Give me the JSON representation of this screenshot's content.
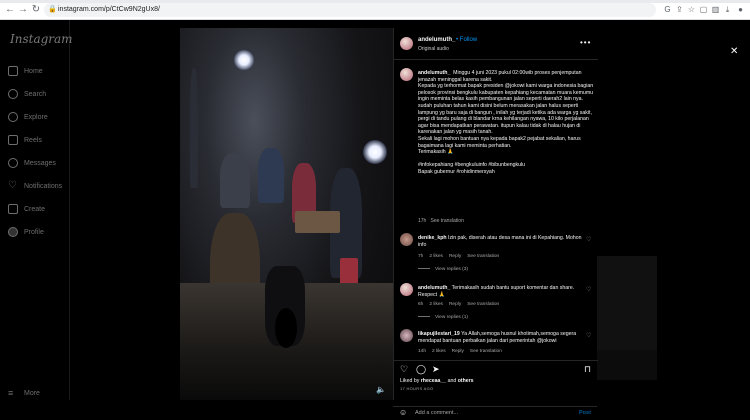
{
  "browser": {
    "url": "instagram.com/p/CtCw9N2gUx8/"
  },
  "sidebar": {
    "logo": "Instagram",
    "items": [
      {
        "label": "Home",
        "icon": "home-icon"
      },
      {
        "label": "Search",
        "icon": "search-icon"
      },
      {
        "label": "Explore",
        "icon": "explore-icon"
      },
      {
        "label": "Reels",
        "icon": "reels-icon"
      },
      {
        "label": "Messages",
        "icon": "messages-icon"
      },
      {
        "label": "Notifications",
        "icon": "heart-icon"
      },
      {
        "label": "Create",
        "icon": "create-icon"
      },
      {
        "label": "Profile",
        "icon": "profile-icon"
      }
    ],
    "more": "More"
  },
  "post": {
    "author": "andelumuth_",
    "follow": "Follow",
    "audio": "Original audio",
    "caption_author": "andelumuth_",
    "caption": "Minggu 4 juni 2023 pukul 02:00wib proses penjemputan jenazah meninggal karena sakit.\nKepada yg terhormat bapak presiden @jokowi kami warga indonesia bagian pelosok provinsi bengkulu kabupaten kepahiang kecamatan muara kemumu ingin meminta belas kasih pembangunan jalan seperti daerah2 lain nya. sudah puluhan tahun kami disini belum merasakan jalan halus seperti lampung yg baru saja di bangun , inilah yg terjadi ketika ada warga yg sakit, pergi di tandu pulang di blandar krna kehilangan nyawa, 10 kilo perjalanan agar bisa mendapatkan perawatan. itupun kalau tidak di halau hujan di karenakan jalan yg masih tanah.\nSekali lagi mohon bantuan nya kepada bapak2 pejabat sekalian, harus bagaimana lagi kami meminta perhatian.\nTerimakasih 🙏\n\n#infokepahiang #bengkuluinfo #bibunbengkulu\nBapak gubernur #rohidinmersyah",
    "caption_time": "17h",
    "see_translation": "See translation",
    "comments": [
      {
        "user": "denike_kph",
        "text": "Izin pak, diserah atau desa mana ini di Kepahiang. Mohon info",
        "time": "7h",
        "likes": "2 likes",
        "reply": "Reply",
        "translate": "See translation",
        "view_replies": "View replies (3)"
      },
      {
        "user": "andelumuth_",
        "text": "Terimakasih sudah bantu suport komentar dan share. Respect 🙏",
        "time": "6h",
        "likes": "2 likes",
        "reply": "Reply",
        "translate": "See translation",
        "view_replies": "View replies (1)"
      },
      {
        "user": "likapujilestari_19",
        "text": "Ya Allah,semoga husnul khotimah,semoga segera mendapat bantuan perbaikan jalan dari pemerintah @jokowi",
        "time": "14h",
        "likes": "2 likes",
        "reply": "Reply",
        "translate": "See translation"
      }
    ],
    "liked_by_prefix": "Liked by ",
    "liked_by_user": "rheceaa__",
    "liked_by_and": " and ",
    "liked_by_others": "others",
    "time_ago": "17 HOURS AGO",
    "add_comment_placeholder": "Add a comment...",
    "post_button": "Post"
  }
}
